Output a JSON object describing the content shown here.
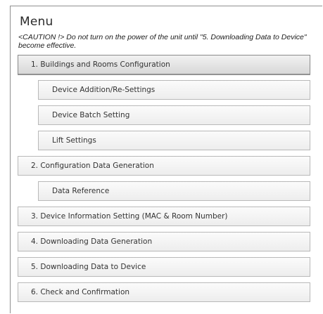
{
  "menu": {
    "title": "Menu",
    "caution_line1": "<CAUTION !> Do not turn on the power of the unit until \"5. Downloading Data to Device\"",
    "caution_line2": "become effective.",
    "items": [
      {
        "label": "1. Buildings and Rooms Configuration",
        "level": "top",
        "active": true
      },
      {
        "label": "Device Addition/Re-Settings",
        "level": "sub"
      },
      {
        "label": "Device Batch Setting",
        "level": "sub"
      },
      {
        "label": "Lift Settings",
        "level": "sub"
      },
      {
        "label": "2. Configuration Data Generation",
        "level": "top"
      },
      {
        "label": "Data Reference",
        "level": "sub"
      },
      {
        "label": "3. Device Information Setting (MAC & Room Number)",
        "level": "top"
      },
      {
        "label": "4. Downloading Data Generation",
        "level": "top"
      },
      {
        "label": "5. Downloading Data to Device",
        "level": "top"
      },
      {
        "label": "6. Check and Confirmation",
        "level": "top"
      }
    ]
  }
}
